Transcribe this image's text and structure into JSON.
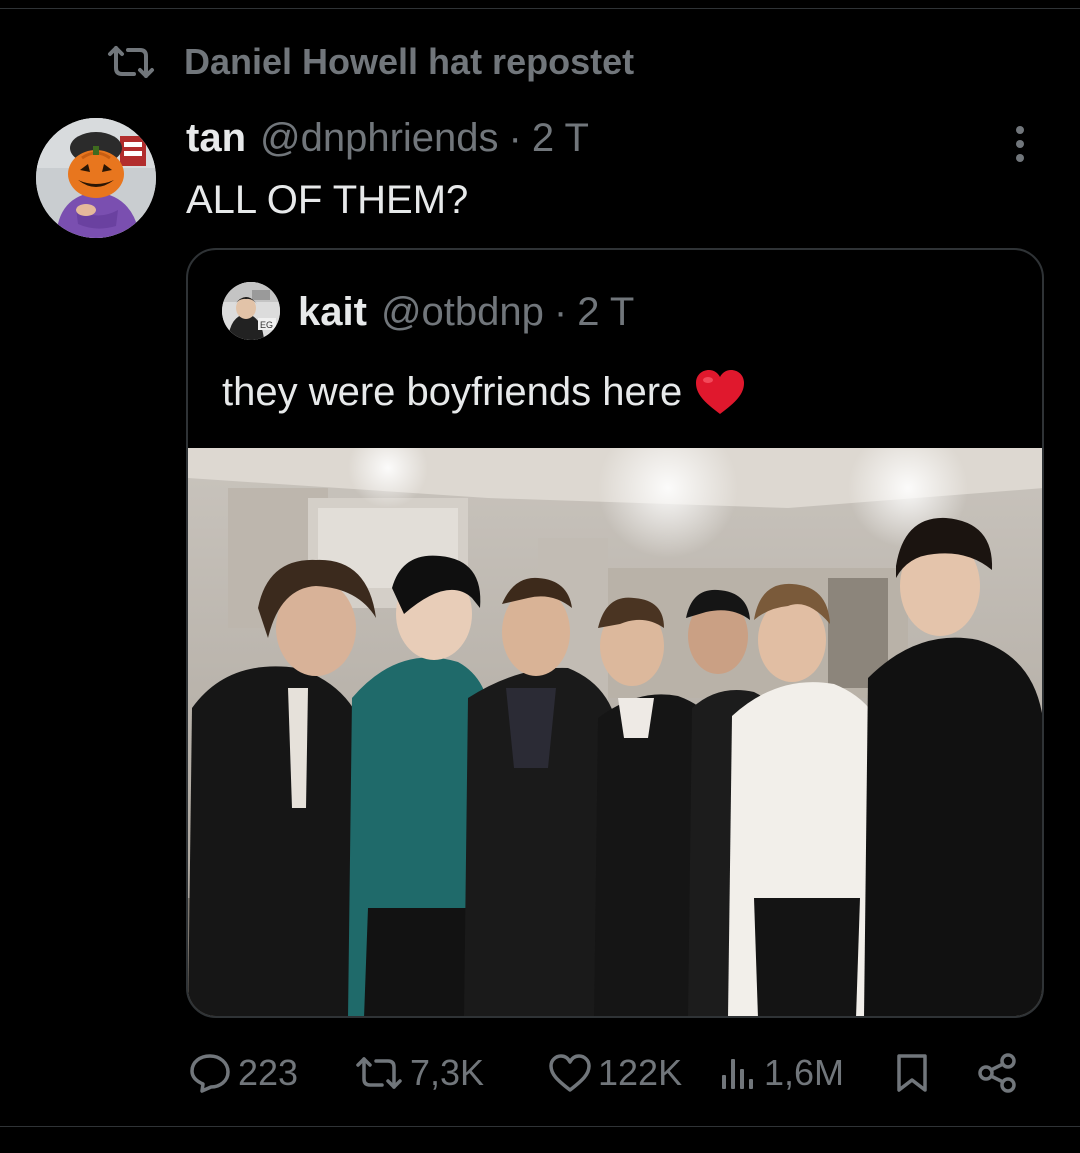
{
  "repost": {
    "text": "Daniel Howell hat repostet",
    "icon": "repost-icon"
  },
  "tweet": {
    "author_name": "tan",
    "handle": "@dnphriends",
    "separator": "·",
    "time": "2 T",
    "text": "ALL OF THEM?",
    "avatar_icon": "pumpkin-avatar"
  },
  "quote": {
    "author_name": "kait",
    "handle": "@otbdnp",
    "separator": "·",
    "time": "2 T",
    "text": "they were boyfriends here",
    "emoji": "red-heart-emoji",
    "image": "group-photo"
  },
  "actions": {
    "replies": "223",
    "reposts": "7,3K",
    "likes": "122K",
    "views": "1,6M"
  },
  "colors": {
    "background": "#000000",
    "primary_text": "#e7e9ea",
    "secondary_text": "#71767b",
    "border": "#2f3336",
    "heart": "#e0182d"
  }
}
